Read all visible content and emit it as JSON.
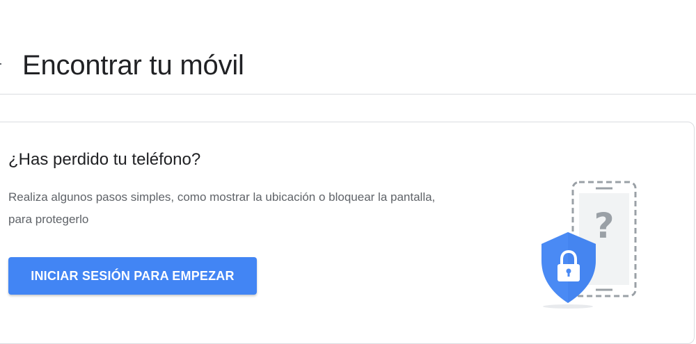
{
  "header": {
    "title": "Encontrar tu móvil",
    "back_icon": "arrow-back-icon"
  },
  "card": {
    "title": "¿Has perdido tu teléfono?",
    "description": "Realiza algunos pasos simples, como mostrar la ubicación o bloquear la pantalla, para protegerlo",
    "button_label": "INICIAR SESIÓN PARA EMPEZAR",
    "illustration_icon": "lost-phone-shield-icon"
  },
  "colors": {
    "accent": "#4285f4",
    "shield": "#4a8af4",
    "title_text": "#202124",
    "body_text": "#5f6368",
    "divider": "#dadce0"
  }
}
